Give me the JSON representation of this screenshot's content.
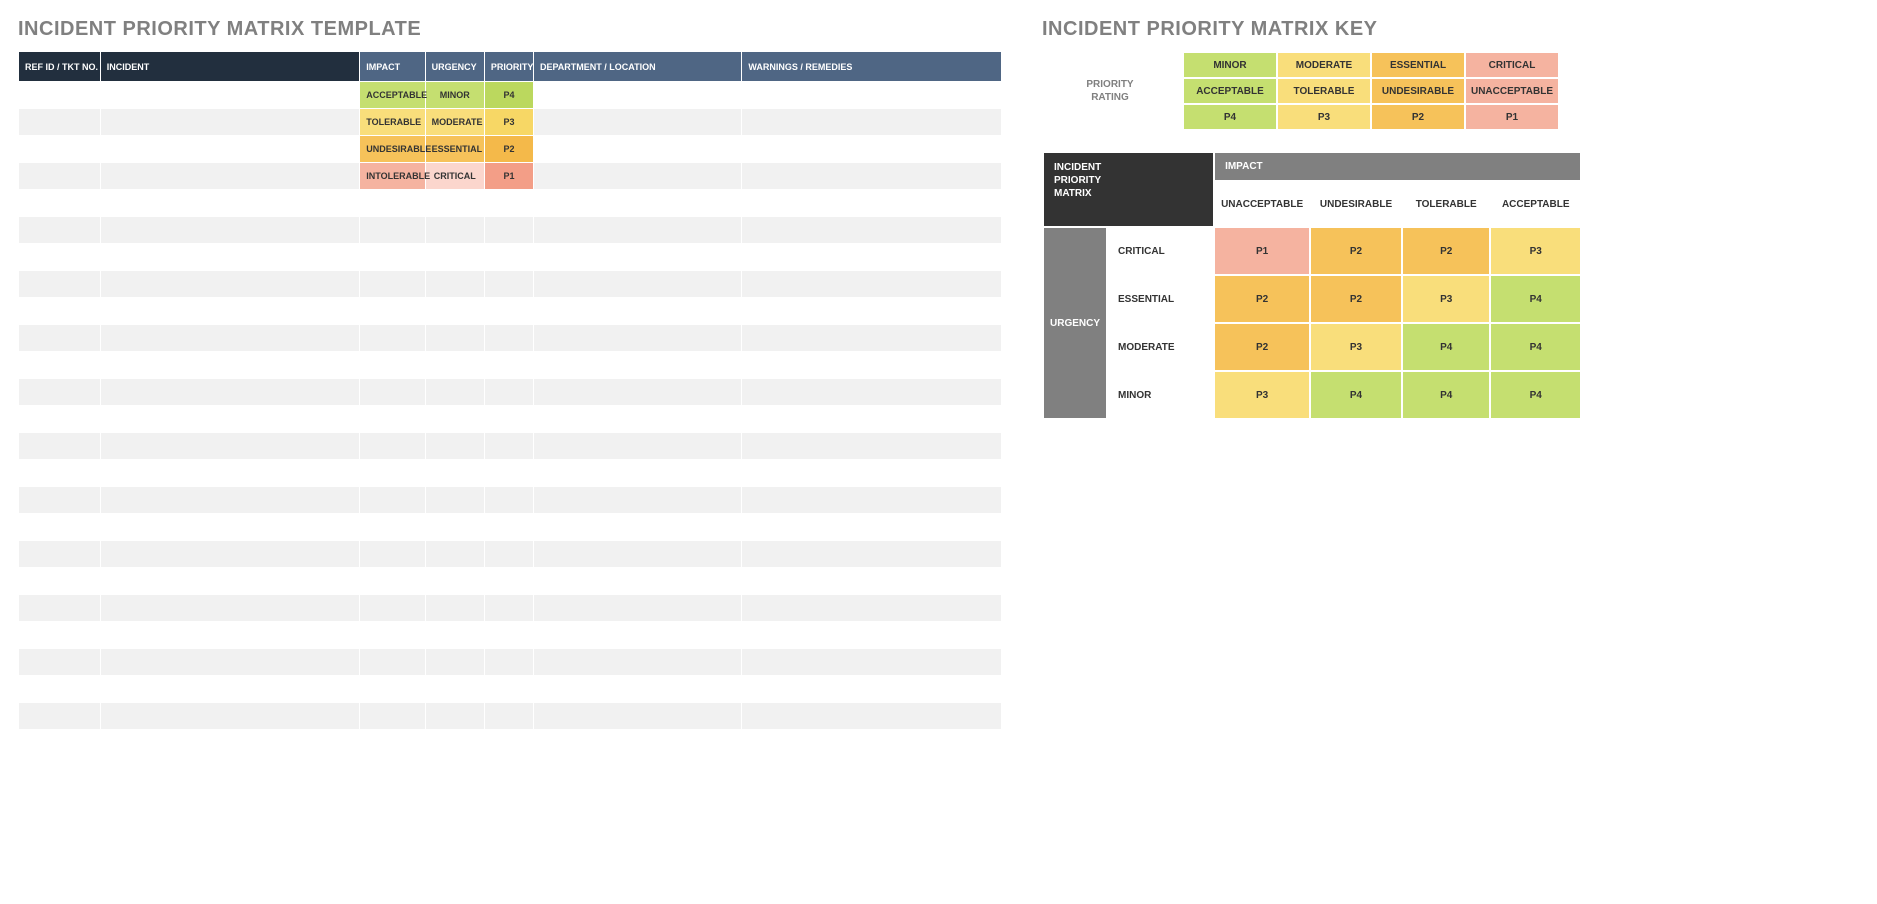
{
  "template": {
    "title": "INCIDENT PRIORITY MATRIX TEMPLATE",
    "headers": {
      "ref": "REF ID / TKT NO.",
      "incident": "INCIDENT",
      "impact": "IMPACT",
      "urgency": "URGENCY",
      "priority": "PRIORITY",
      "dept": "DEPARTMENT / LOCATION",
      "warn": "WARNINGS / REMEDIES"
    },
    "rows": [
      {
        "impact": "ACCEPTABLE",
        "urgency": "MINOR",
        "priority": "P4",
        "ic": "c-green1",
        "uc": "c-green1",
        "pc": "c-green2"
      },
      {
        "impact": "TOLERABLE",
        "urgency": "MODERATE",
        "priority": "P3",
        "ic": "c-yel1",
        "uc": "c-yel1",
        "pc": "c-yel2"
      },
      {
        "impact": "UNDESIRABLE",
        "urgency": "ESSENTIAL",
        "priority": "P2",
        "ic": "c-or1",
        "uc": "c-or1",
        "pc": "c-or2"
      },
      {
        "impact": "INTOLERABLE",
        "urgency": "CRITICAL",
        "priority": "P1",
        "ic": "c-pink1",
        "uc": "c-pinkL",
        "pc": "c-pink2"
      }
    ],
    "blankRowsAfter": 21
  },
  "key": {
    "title": "INCIDENT PRIORITY MATRIX KEY",
    "ratingLabel": "PRIORITY\nRATING",
    "rating": {
      "cols": [
        {
          "h": "MINOR",
          "m": "ACCEPTABLE",
          "p": "P4",
          "c": "c-green1"
        },
        {
          "h": "MODERATE",
          "m": "TOLERABLE",
          "p": "P3",
          "c": "c-yel1"
        },
        {
          "h": "ESSENTIAL",
          "m": "UNDESIRABLE",
          "p": "P2",
          "c": "c-or1"
        },
        {
          "h": "CRITICAL",
          "m": "UNACCEPTABLE",
          "p": "P1",
          "c": "c-pink1"
        }
      ]
    },
    "matrix": {
      "corner": "INCIDENT\nPRIORITY\nMATRIX",
      "impactLabel": "IMPACT",
      "urgencyLabel": "URGENCY",
      "impactHeaders": [
        "UNACCEPTABLE",
        "UNDESIRABLE",
        "TOLERABLE",
        "ACCEPTABLE"
      ],
      "rows": [
        {
          "label": "CRITICAL",
          "cells": [
            {
              "v": "P1",
              "c": "c-pink1"
            },
            {
              "v": "P2",
              "c": "c-or1"
            },
            {
              "v": "P2",
              "c": "c-or1"
            },
            {
              "v": "P3",
              "c": "c-yel1"
            }
          ]
        },
        {
          "label": "ESSENTIAL",
          "cells": [
            {
              "v": "P2",
              "c": "c-or1"
            },
            {
              "v": "P2",
              "c": "c-or1"
            },
            {
              "v": "P3",
              "c": "c-yel1"
            },
            {
              "v": "P4",
              "c": "c-green1"
            }
          ]
        },
        {
          "label": "MODERATE",
          "cells": [
            {
              "v": "P2",
              "c": "c-or1"
            },
            {
              "v": "P3",
              "c": "c-yel1"
            },
            {
              "v": "P4",
              "c": "c-green1"
            },
            {
              "v": "P4",
              "c": "c-green1"
            }
          ]
        },
        {
          "label": "MINOR",
          "cells": [
            {
              "v": "P3",
              "c": "c-yel1"
            },
            {
              "v": "P4",
              "c": "c-green1"
            },
            {
              "v": "P4",
              "c": "c-green1"
            },
            {
              "v": "P4",
              "c": "c-green1"
            }
          ]
        }
      ]
    }
  }
}
